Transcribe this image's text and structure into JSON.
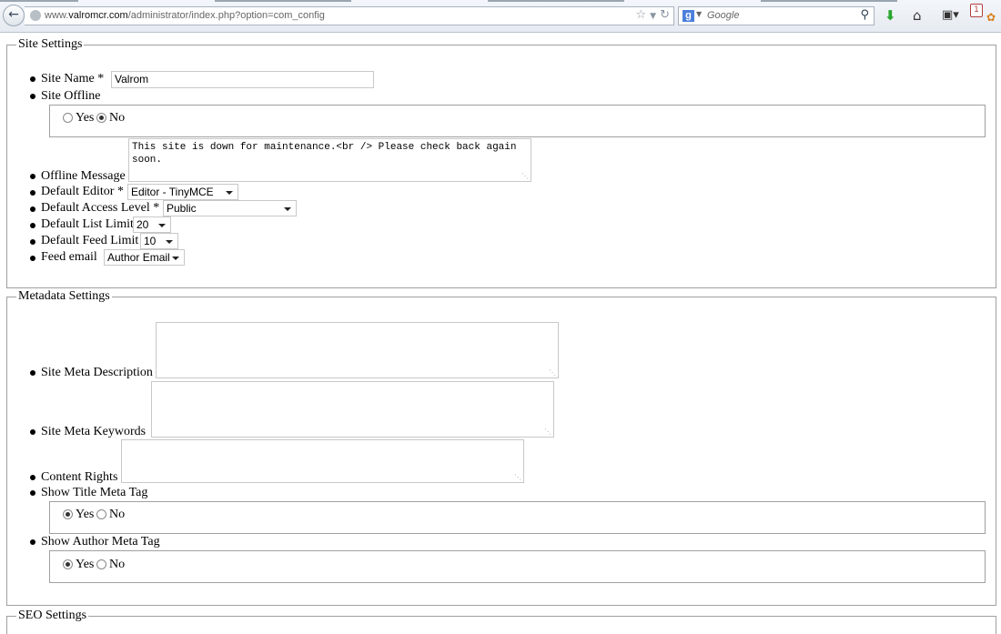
{
  "browser": {
    "url_prefix": "www.",
    "url_domain": "valromcr.com",
    "url_path": "/administrator/index.php?option=com_config",
    "search_placeholder": "Google",
    "notification_count": "1"
  },
  "site_settings": {
    "legend": "Site Settings",
    "site_name_label": "Site Name *",
    "site_name_value": "Valrom",
    "site_offline_label": "Site Offline",
    "offline_yes": "Yes",
    "offline_no": "No",
    "offline_selected": "No",
    "offline_message_label": "Offline Message",
    "offline_message_value": "This site is down for maintenance.<br /> Please check back again soon.",
    "default_editor_label": "Default Editor *",
    "default_editor_value": "Editor - TinyMCE",
    "default_access_label": "Default Access Level *",
    "default_access_value": "Public",
    "default_list_limit_label": "Default List Limit",
    "default_list_limit_value": "20",
    "default_feed_limit_label": "Default Feed Limit",
    "default_feed_limit_value": "10",
    "feed_email_label": "Feed email",
    "feed_email_value": "Author Email"
  },
  "metadata_settings": {
    "legend": "Metadata Settings",
    "meta_description_label": "Site Meta Description",
    "meta_keywords_label": "Site Meta Keywords",
    "content_rights_label": "Content Rights",
    "show_title_label": "Show Title Meta Tag",
    "show_title_yes": "Yes",
    "show_title_no": "No",
    "show_title_selected": "Yes",
    "show_author_label": "Show Author Meta Tag",
    "show_author_yes": "Yes",
    "show_author_no": "No",
    "show_author_selected": "Yes"
  },
  "seo_settings": {
    "legend": "SEO Settings"
  }
}
